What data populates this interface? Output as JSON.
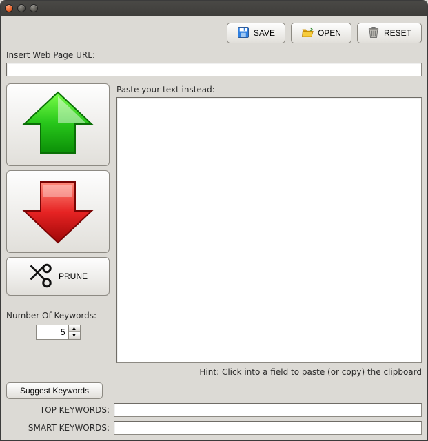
{
  "toolbar": {
    "save_label": "SAVE",
    "open_label": "OPEN",
    "reset_label": "RESET"
  },
  "url_section": {
    "label": "Insert Web Page URL:",
    "value": ""
  },
  "left_panel": {
    "prune_label": "PRUNE",
    "num_keywords_label": "Number Of Keywords:",
    "num_keywords_value": "5"
  },
  "text_section": {
    "label": "Paste your text instead:",
    "value": ""
  },
  "hint": "Hint: Click into a field to paste (or copy) the clipboard",
  "suggest_label": "Suggest Keywords",
  "keywords": {
    "top_label": "TOP KEYWORDS:",
    "top_value": "",
    "smart_label": "SMART KEYWORDS:",
    "smart_value": ""
  }
}
